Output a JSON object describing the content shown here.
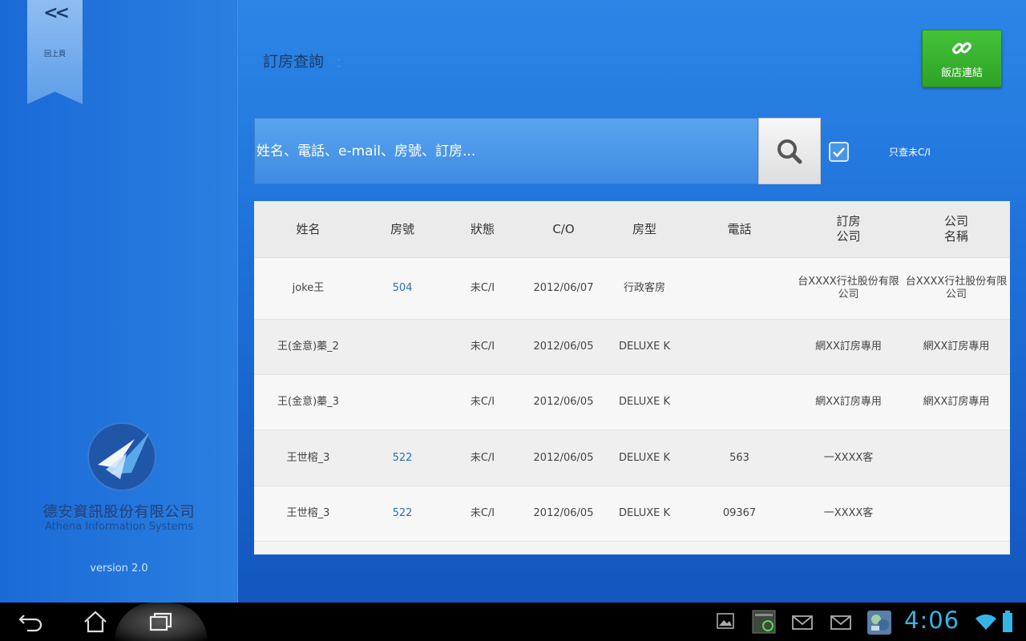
{
  "sidebar": {
    "back_label": "回上頁",
    "company_zh": "德安資訊股份有限公司",
    "company_en": "Athena Information Systems",
    "version": "version 2.0"
  },
  "header": {
    "title": "訂房查詢",
    "hotel_link_label": "飯店連結"
  },
  "search": {
    "placeholder": "姓名、電話、e-mail、房號、訂房...",
    "value": "",
    "only_not_checked_in_label": "只查未C/I",
    "only_not_checked_in": true
  },
  "table": {
    "headers": [
      "姓名",
      "房號",
      "狀態",
      "C/O",
      "房型",
      "電話",
      "訂房\n公司",
      "公司\n名稱"
    ],
    "rows": [
      [
        "joke王",
        "504",
        "未C/I",
        "2012/06/07",
        "行政客房",
        "",
        "台XXXX行社股份有限公司",
        "台XXXX行社股份有限公司"
      ],
      [
        "王(金意)蓁_2",
        "",
        "未C/I",
        "2012/06/05",
        "DELUXE K",
        "",
        "網XX訂房專用",
        "網XX訂房專用"
      ],
      [
        "王(金意)蓁_3",
        "",
        "未C/I",
        "2012/06/05",
        "DELUXE K",
        "",
        "網XX訂房專用",
        "網XX訂房專用"
      ],
      [
        "王世榕_3",
        "522",
        "未C/I",
        "2012/06/05",
        "DELUXE K",
        "563",
        "一XXXX客",
        ""
      ],
      [
        "王世榕_3",
        "522",
        "未C/I",
        "2012/06/05",
        "DELUXE K",
        "09367",
        "一XXXX客",
        ""
      ]
    ]
  },
  "statusbar": {
    "time": "4:06"
  },
  "colors": {
    "accent_green": "#3bb531",
    "link_blue": "#2a6fb8",
    "clock_blue": "#33b5e5"
  }
}
